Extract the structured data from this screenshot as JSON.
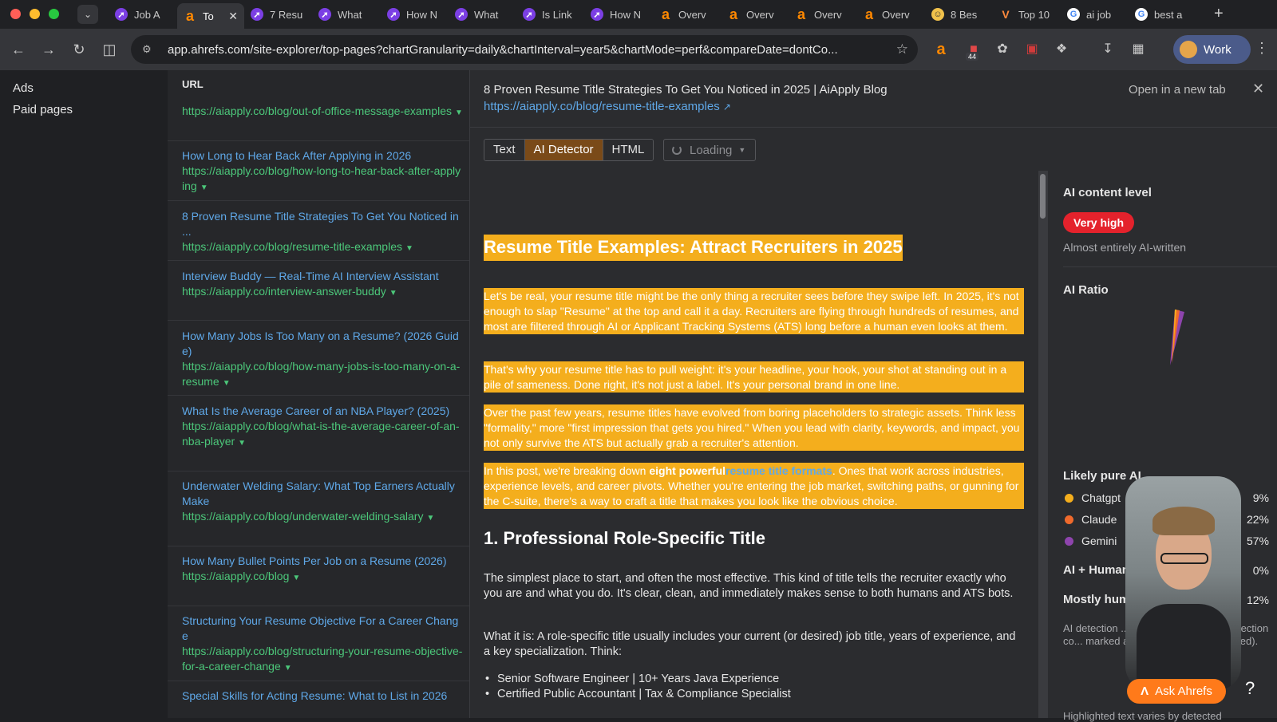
{
  "tabs": [
    {
      "label": "Job A",
      "icon": "purple"
    },
    {
      "label": "To",
      "icon": "ahrefs",
      "active": true
    },
    {
      "label": "7 Resu",
      "icon": "purple"
    },
    {
      "label": "What",
      "icon": "purple"
    },
    {
      "label": "How N",
      "icon": "purple"
    },
    {
      "label": "What",
      "icon": "purple"
    },
    {
      "label": "Is Link",
      "icon": "purple"
    },
    {
      "label": "How N",
      "icon": "purple"
    },
    {
      "label": "Overv",
      "icon": "ahrefs"
    },
    {
      "label": "Overv",
      "icon": "ahrefs"
    },
    {
      "label": "Overv",
      "icon": "ahrefs"
    },
    {
      "label": "Overv",
      "icon": "ahrefs"
    },
    {
      "label": "8 Bes",
      "icon": "face"
    },
    {
      "label": "Top 10",
      "icon": "vv"
    },
    {
      "label": "ai job",
      "icon": "google"
    },
    {
      "label": "best a",
      "icon": "google"
    }
  ],
  "toolbar": {
    "url": "app.ahrefs.com/site-explorer/top-pages?chartGranularity=daily&chartInterval=year5&chartMode=perf&compareDate=dontCo...",
    "ext_badge": "44",
    "profile_label": "Work"
  },
  "leftnav": {
    "items": [
      "Ads",
      "Paid pages"
    ]
  },
  "urllist": {
    "header": "URL",
    "rows": [
      {
        "title": "",
        "url": "https://aiapply.co/blog/out-of-office-message-examples"
      },
      {
        "title": "How Long to Hear Back After Applying in 2026",
        "url": "https://aiapply.co/blog/how-long-to-hear-back-after-applying"
      },
      {
        "title": "8 Proven Resume Title Strategies To Get You Noticed in ...",
        "url": "https://aiapply.co/blog/resume-title-examples"
      },
      {
        "title": "Interview Buddy — Real-Time AI Interview Assistant",
        "url": "https://aiapply.co/interview-answer-buddy"
      },
      {
        "title": "How Many Jobs Is Too Many on a Resume? (2026 Guide)",
        "url": "https://aiapply.co/blog/how-many-jobs-is-too-many-on-a-resume"
      },
      {
        "title": "What Is the Average Career of an NBA Player? (2025)",
        "url": "https://aiapply.co/blog/what-is-the-average-career-of-an-nba-player"
      },
      {
        "title": "Underwater Welding Salary: What Top Earners Actually Make",
        "url": "https://aiapply.co/blog/underwater-welding-salary"
      },
      {
        "title": "How Many Bullet Points Per Job on a Resume (2026)",
        "url": "https://aiapply.co/blog"
      },
      {
        "title": "Structuring Your Resume Objective For a Career Change",
        "url": "https://aiapply.co/blog/structuring-your-resume-objective-for-a-career-change"
      },
      {
        "title": "Special Skills for Acting Resume: What to List in 2026",
        "url": ""
      }
    ]
  },
  "preview": {
    "title": "8 Proven Resume Title Strategies To Get You Noticed in 2025 | AiApply Blog",
    "link": "https://aiapply.co/blog/resume-title-examples",
    "open_new_tab": "Open in a new tab",
    "modes": [
      "Text",
      "AI Detector",
      "HTML"
    ],
    "active_mode": "AI Detector",
    "loading_label": "Loading",
    "h1": "Resume Title Examples: Attract Recruiters in 2025",
    "p1": "Let's be real, your resume title might be the only thing a recruiter sees before they swipe left. In 2025, it's not enough to slap \"Resume\" at the top and call it a day. Recruiters are flying through hundreds of resumes, and most are filtered through AI or Applicant Tracking Systems (ATS) long before a human even looks at them.",
    "p2": "That's why your resume title has to pull weight: it's your headline, your hook, your shot at standing out in a pile of sameness. Done right, it's not just a label. It's your personal brand in one line.",
    "p3": "Over the past few years, resume titles have evolved from boring placeholders to strategic assets. Think less \"formality,\" more \"first impression that gets you hired.\" When you lead with clarity, keywords, and impact, you not only survive the ATS but actually grab a recruiter's attention.",
    "p4_a": "In this post, we're breaking down ",
    "p4_bold": "eight powerful",
    "p4_link": "resume title formats",
    "p4_b": ". Ones that work across industries, experience levels, and career pivots. Whether you're entering the job market, switching paths, or gunning for the C-suite, there's a way to craft a title that makes you look like the obvious choice.",
    "h2": "1. Professional Role-Specific Title",
    "body1": "The simplest place to start, and often the most effective. This kind of title tells the recruiter exactly who you are and what you do. It's clear, clean, and immediately makes sense to both humans and ATS bots.",
    "body2": "What it is: A role-specific title usually includes your current (or desired) job title, years of experience, and a key specialization. Think:",
    "bullets": [
      "Senior Software Engineer | 10+ Years Java Experience",
      "Certified Public Accountant | Tax & Compliance Specialist"
    ]
  },
  "ai_panel": {
    "content_level_label": "AI content level",
    "level_value": "Very high",
    "level_desc": "Almost entirely AI-written",
    "ratio_label": "AI Ratio",
    "likely_pure_label": "Likely pure AI",
    "models": [
      {
        "name": "Chatgpt",
        "pct": "9%",
        "color": "#f4ae1d"
      },
      {
        "name": "Claude",
        "pct": "22%",
        "color": "#f06a2c"
      },
      {
        "name": "Gemini",
        "pct": "57%",
        "color": "#8e44ad"
      }
    ],
    "ai_human_label": "AI + Human",
    "ai_human_pct": "0%",
    "mostly_human_label": "Mostly hum",
    "mostly_human_pct": "12%",
    "note": "AI detection ... nd is not always 1... detection co... marked as Li... Human mix ... edited).",
    "note2": "Highlighted text varies by detected"
  },
  "assistant": {
    "ask_label": "Ask Ahrefs",
    "help": "?"
  },
  "colors": {
    "highlight": "#f4ae1d",
    "link": "#5fa8e8",
    "url_green": "#4cc77a",
    "pill_red": "#e4222c",
    "ask_orange": "#ff7a1a"
  }
}
